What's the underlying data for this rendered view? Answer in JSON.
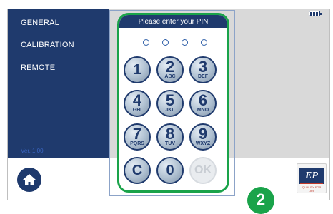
{
  "sidebar": {
    "items": [
      {
        "label": "GENERAL"
      },
      {
        "label": "CALIBRATION"
      },
      {
        "label": "REMOTE"
      }
    ],
    "footer_text": "Ver. 1.00"
  },
  "pin_dialog": {
    "title": "Please enter your PIN",
    "entered_digits": 0,
    "pin_length": 4,
    "keys": [
      {
        "digit": "1",
        "letters": ""
      },
      {
        "digit": "2",
        "letters": "ABC"
      },
      {
        "digit": "3",
        "letters": "DEF"
      },
      {
        "digit": "4",
        "letters": "GHI"
      },
      {
        "digit": "5",
        "letters": "JKL"
      },
      {
        "digit": "6",
        "letters": "MNO"
      },
      {
        "digit": "7",
        "letters": "PQRS"
      },
      {
        "digit": "8",
        "letters": "TUV"
      },
      {
        "digit": "9",
        "letters": "WXYZ"
      },
      {
        "digit": "C",
        "letters": ""
      },
      {
        "digit": "0",
        "letters": ""
      },
      {
        "digit": "OK",
        "letters": ""
      }
    ],
    "ok_enabled": false
  },
  "logo": {
    "text": "EP",
    "tagline": "QUALITY FOR LIFE"
  },
  "step_badge": "2",
  "colors": {
    "navy": "#1f3a6d",
    "highlight_green": "#1aa34a",
    "screen_gray": "#d9d9d9"
  },
  "icons": {
    "home": "home-icon",
    "battery": "battery-icon"
  }
}
